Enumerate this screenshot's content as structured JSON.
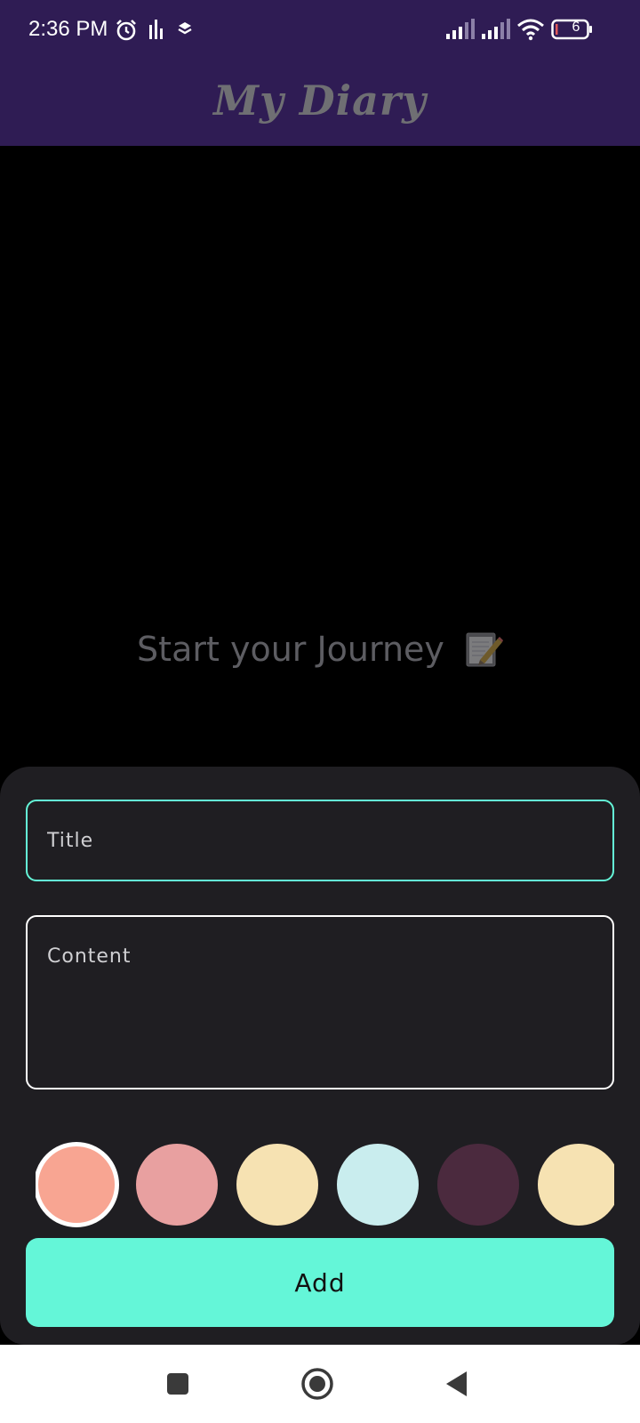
{
  "status_bar": {
    "time": "2:36 PM",
    "battery_level": "6",
    "icons": [
      "alarm-icon",
      "activity-icon",
      "layers-icon",
      "signal-icon",
      "signal-icon",
      "wifi-icon",
      "battery-icon"
    ]
  },
  "app_bar": {
    "title": "My Diary"
  },
  "empty_state": {
    "text": "Start your Journey",
    "emoji_icon": "memo-pencil-icon"
  },
  "form": {
    "title_placeholder": "Title",
    "content_placeholder": "Content",
    "colors": [
      "#f8a592",
      "#e8a0a0",
      "#f6e2b2",
      "#c9edee",
      "#4b2a3e",
      "#f6e2b2"
    ],
    "selected_color_index": 0,
    "add_label": "Add",
    "focus_border_color": "#64f6d8",
    "button_color": "#64f6d8"
  },
  "nav_bar": {
    "buttons": [
      "recents-square-icon",
      "home-circle-icon",
      "back-triangle-icon"
    ]
  }
}
